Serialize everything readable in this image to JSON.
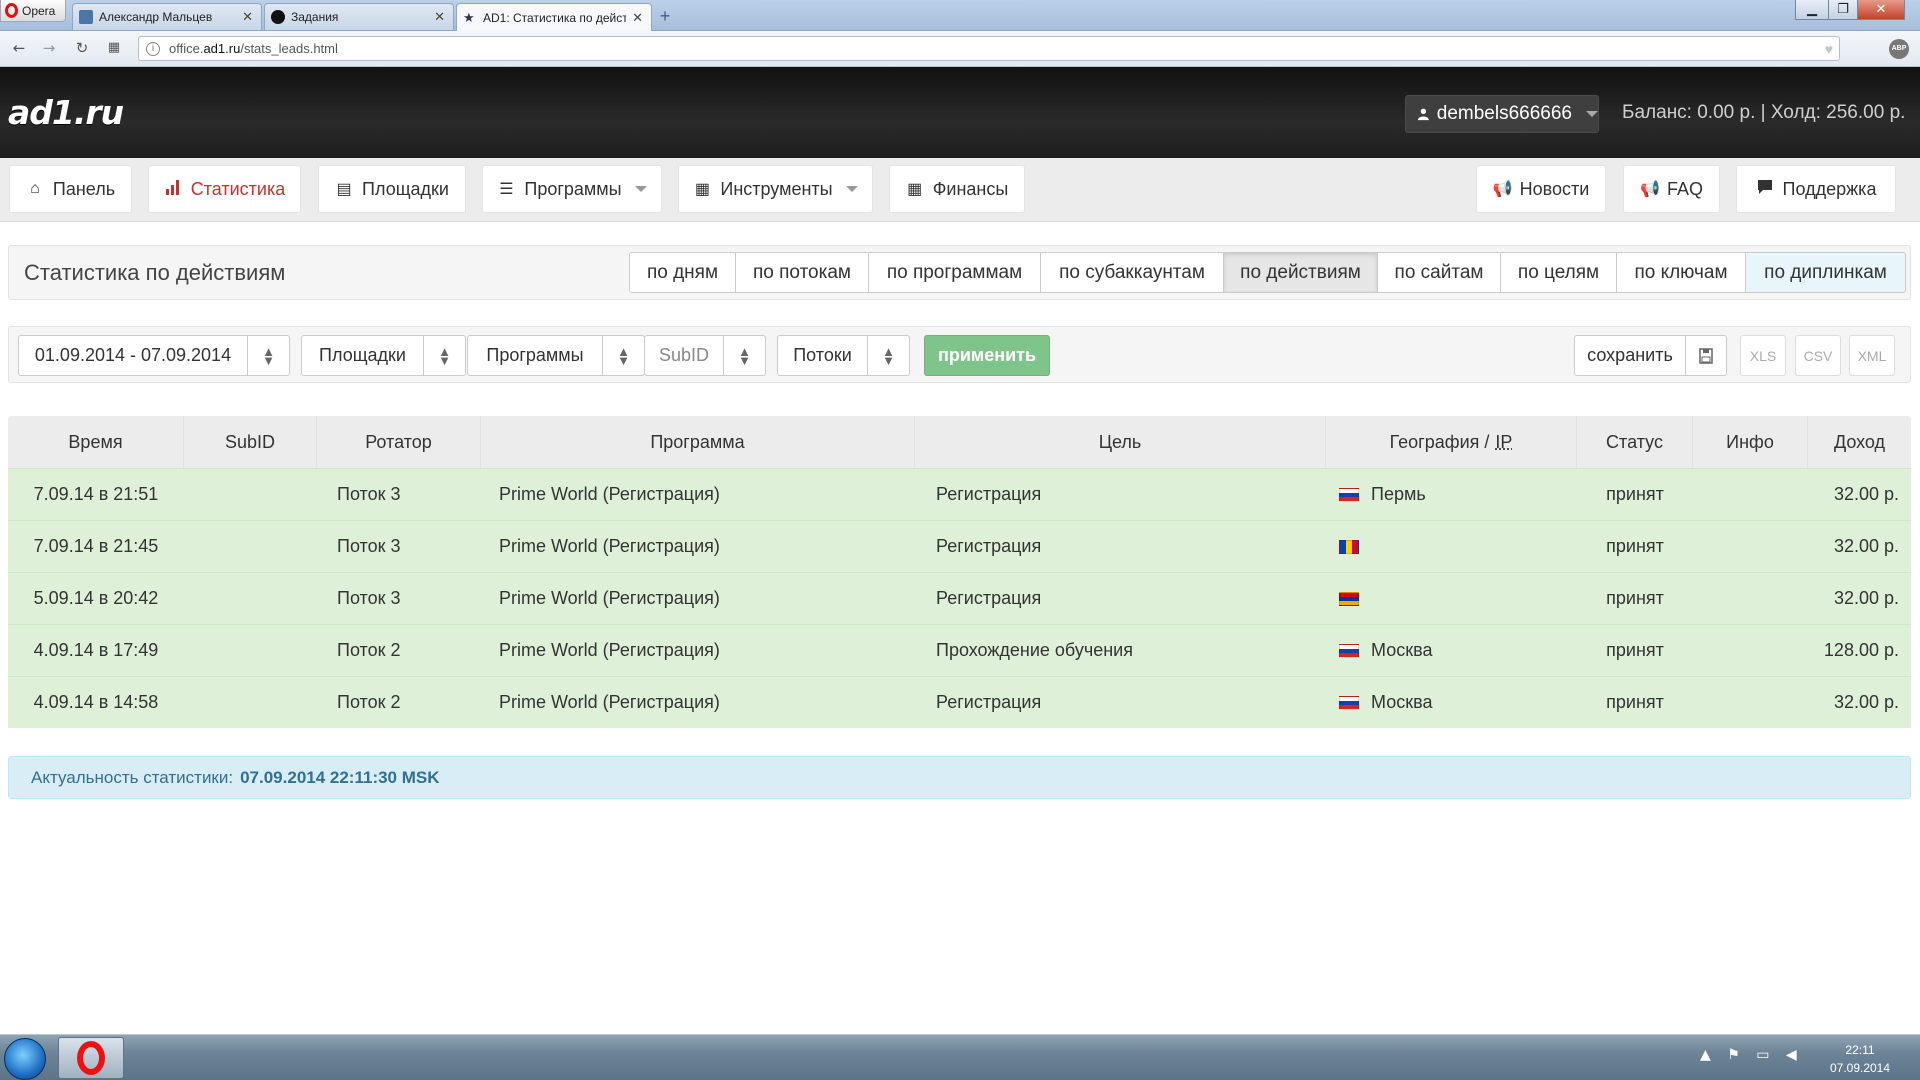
{
  "browser": {
    "menu_label": "Opera",
    "tabs": [
      {
        "title": "Александр Мальцев"
      },
      {
        "title": "Задания"
      },
      {
        "title": "AD1: Статистика по дейст"
      }
    ],
    "url_prefix": "office.",
    "url_domain": "ad1.ru",
    "url_path": "/stats_leads.html"
  },
  "header": {
    "logo": "ad1.ru",
    "username": "dembels666666",
    "balance": "Баланс: 0.00 р.  |  Холд: 256.00 р."
  },
  "nav": {
    "panel": "Панель",
    "stats": "Статистика",
    "sites": "Площадки",
    "programs": "Программы",
    "tools": "Инструменты",
    "finance": "Финансы",
    "news": "Новости",
    "faq": "FAQ",
    "support": "Поддержка"
  },
  "page": {
    "title": "Статистика по действиям",
    "segments": [
      "по дням",
      "по потокам",
      "по программам",
      "по субаккаунтам",
      "по действиям",
      "по сайтам",
      "по целям",
      "по ключам",
      "по диплинкам"
    ]
  },
  "filters": {
    "date_range": "01.09.2014 - 07.09.2014",
    "sites": "Площадки",
    "programs": "Программы",
    "subid": "SubID",
    "streams": "Потоки",
    "apply": "применить",
    "save": "сохранить",
    "xls": "XLS",
    "csv": "CSV",
    "xml": "XML"
  },
  "table": {
    "headers": {
      "time": "Время",
      "subid": "SubID",
      "rotator": "Ротатор",
      "program": "Программа",
      "goal": "Цель",
      "geo": "География /",
      "ip": "IP",
      "status": "Статус",
      "info": "Инфо",
      "income": "Доход"
    },
    "rows": [
      {
        "time": "7.09.14 в 21:51",
        "subid": "",
        "rotator": "Поток 3",
        "program": "Prime World (Регистрация)",
        "goal": "Регистрация",
        "flag": "ru",
        "city": "Пермь",
        "status": "принят",
        "info": "",
        "income": "32.00 р."
      },
      {
        "time": "7.09.14 в 21:45",
        "subid": "",
        "rotator": "Поток 3",
        "program": "Prime World (Регистрация)",
        "goal": "Регистрация",
        "flag": "md",
        "city": "",
        "status": "принят",
        "info": "",
        "income": "32.00 р."
      },
      {
        "time": "5.09.14 в 20:42",
        "subid": "",
        "rotator": "Поток 3",
        "program": "Prime World (Регистрация)",
        "goal": "Регистрация",
        "flag": "am",
        "city": "",
        "status": "принят",
        "info": "",
        "income": "32.00 р."
      },
      {
        "time": "4.09.14 в 17:49",
        "subid": "",
        "rotator": "Поток 2",
        "program": "Prime World (Регистрация)",
        "goal": "Прохождение обучения",
        "flag": "ru",
        "city": "Москва",
        "status": "принят",
        "info": "",
        "income": "128.00 р."
      },
      {
        "time": "4.09.14 в 14:58",
        "subid": "",
        "rotator": "Поток 2",
        "program": "Prime World (Регистрация)",
        "goal": "Регистрация",
        "flag": "ru",
        "city": "Москва",
        "status": "принят",
        "info": "",
        "income": "32.00 р."
      }
    ]
  },
  "actuality": {
    "label": "Актуальность статистики:",
    "value": "07.09.2014 22:11:30 MSK"
  },
  "taskbar": {
    "time": "22:11",
    "date": "07.09.2014"
  }
}
